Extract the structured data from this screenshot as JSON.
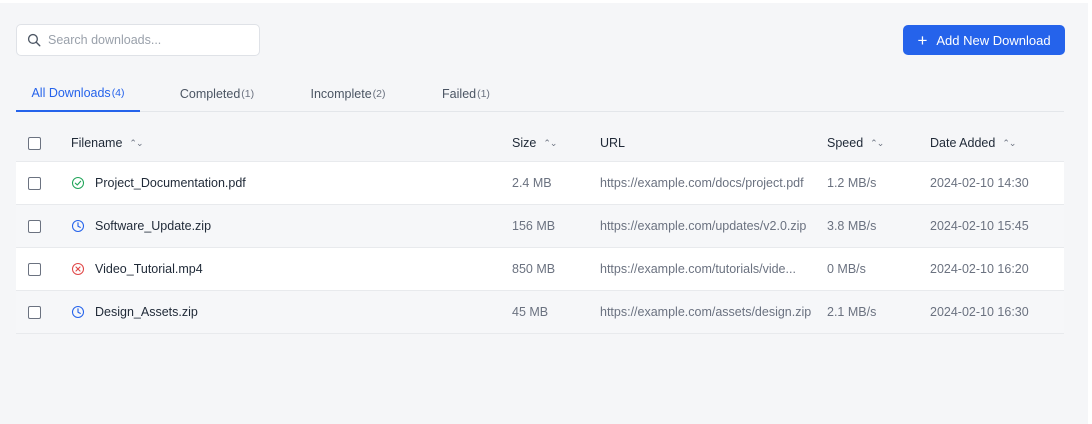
{
  "search": {
    "placeholder": "Search downloads..."
  },
  "add_button": {
    "label": "Add New Download"
  },
  "tabs": [
    {
      "label": "All Downloads",
      "count": "(4)",
      "active": true
    },
    {
      "label": "Completed",
      "count": "(1)"
    },
    {
      "label": "Incomplete",
      "count": "(2)"
    },
    {
      "label": "Failed",
      "count": "(1)"
    }
  ],
  "table": {
    "columns": {
      "filename": "Filename",
      "size": "Size",
      "url": "URL",
      "speed": "Speed",
      "date": "Date Added"
    },
    "rows": [
      {
        "status": "completed",
        "status_icon": "check-circle-icon",
        "filename": "Project_Documentation.pdf",
        "size": "2.4 MB",
        "url": "https://example.com/docs/project.pdf",
        "speed": "1.2 MB/s",
        "date": "2024-02-10 14:30"
      },
      {
        "status": "incomplete",
        "status_icon": "clock-icon",
        "filename": "Software_Update.zip",
        "size": "156 MB",
        "url": "https://example.com/updates/v2.0.zip",
        "speed": "3.8 MB/s",
        "date": "2024-02-10 15:45"
      },
      {
        "status": "failed",
        "status_icon": "x-circle-icon",
        "filename": "Video_Tutorial.mp4",
        "size": "850 MB",
        "url": "https://example.com/tutorials/vide...",
        "speed": "0 MB/s",
        "date": "2024-02-10 16:20"
      },
      {
        "status": "incomplete",
        "status_icon": "clock-icon",
        "filename": "Design_Assets.zip",
        "size": "45 MB",
        "url": "https://example.com/assets/design.zip",
        "speed": "2.1 MB/s",
        "date": "2024-02-10 16:30"
      }
    ]
  },
  "colors": {
    "accent": "#2563eb",
    "completed": "#22a55a",
    "incomplete": "#2563eb",
    "failed": "#e04848"
  }
}
